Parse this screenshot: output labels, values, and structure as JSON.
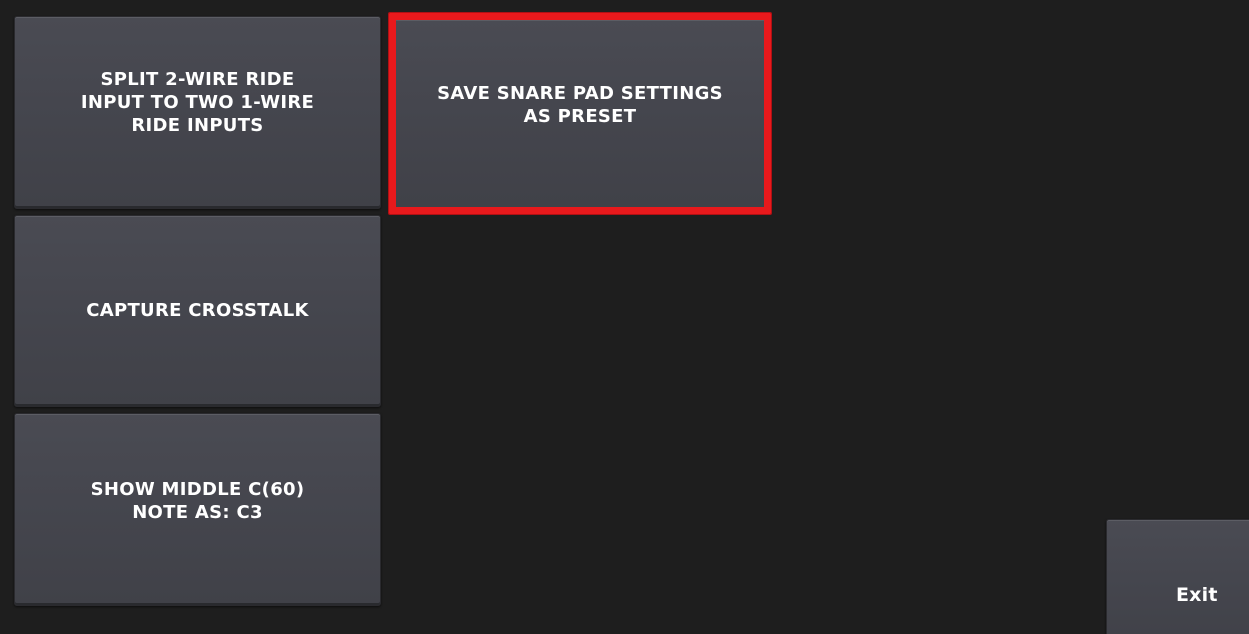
{
  "tiles": {
    "split_ride": "SPLIT 2-WIRE RIDE\nINPUT TO TWO 1-WIRE\nRIDE INPUTS",
    "capture_crosstalk": "CAPTURE CROSSTALK",
    "show_middle_c": "SHOW MIDDLE C(60)\nNOTE AS: C3",
    "save_snare_preset": "SAVE SNARE PAD SETTINGS\nAS PRESET"
  },
  "exit_label": "Exit",
  "colors": {
    "background": "#1e1e1e",
    "tile": "#46474f",
    "highlight": "#e8191c",
    "text": "#ffffff"
  }
}
